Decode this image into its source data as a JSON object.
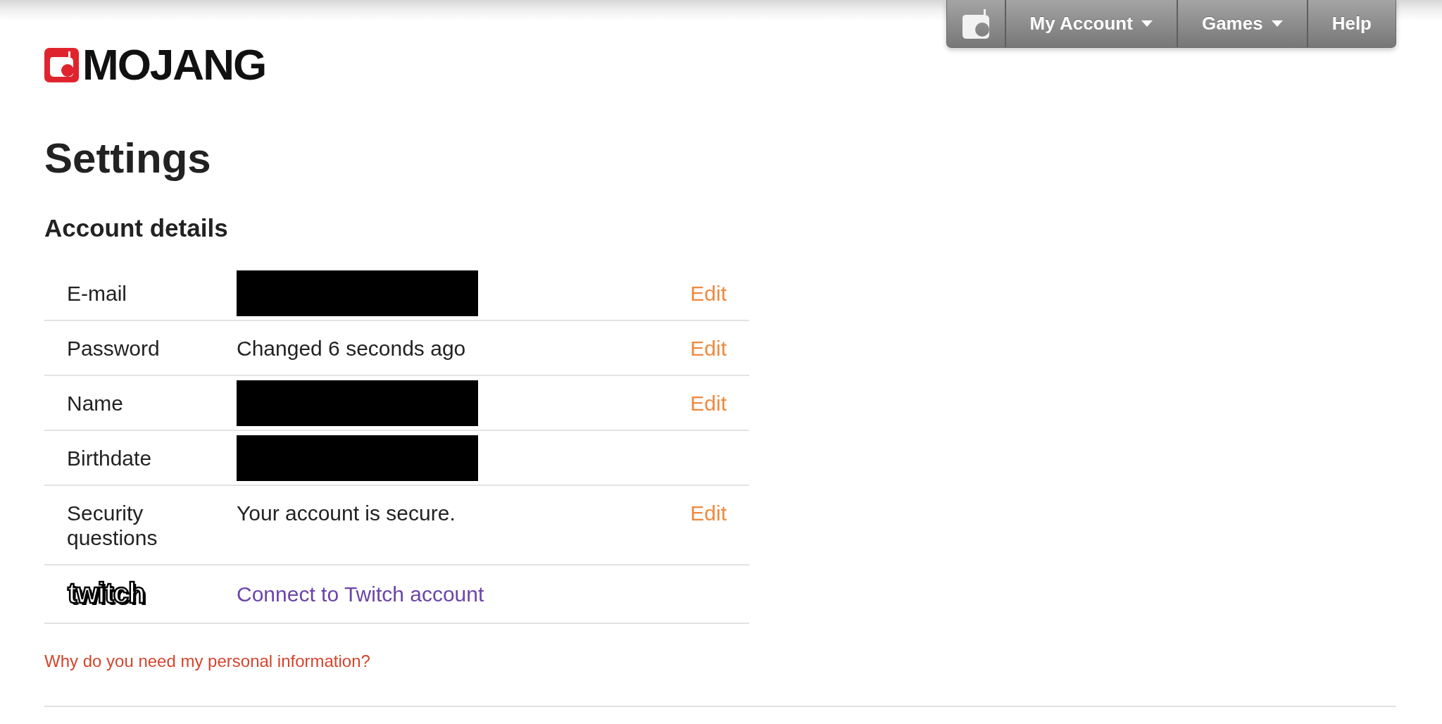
{
  "logo": {
    "text": "MOJANG"
  },
  "nav": {
    "items": [
      {
        "label": "My Account",
        "dropdown": true
      },
      {
        "label": "Games",
        "dropdown": true
      },
      {
        "label": "Help",
        "dropdown": false
      }
    ]
  },
  "page_title": "Settings",
  "section_title": "Account details",
  "rows": [
    {
      "kind": "field",
      "label": "E-mail",
      "redacted": true,
      "action": "Edit"
    },
    {
      "kind": "field",
      "label": "Password",
      "redacted": false,
      "value": "Changed 6 seconds ago",
      "action": "Edit"
    },
    {
      "kind": "field",
      "label": "Name",
      "redacted": true,
      "action": "Edit"
    },
    {
      "kind": "field",
      "label": "Birthdate",
      "redacted": true
    },
    {
      "kind": "field",
      "label": "Security questions",
      "redacted": false,
      "value": "Your account is secure.",
      "action": "Edit"
    },
    {
      "kind": "connect",
      "logo_text": "twitch",
      "link": "Connect to Twitch account"
    }
  ],
  "footer_link": "Why do you need my personal information?"
}
